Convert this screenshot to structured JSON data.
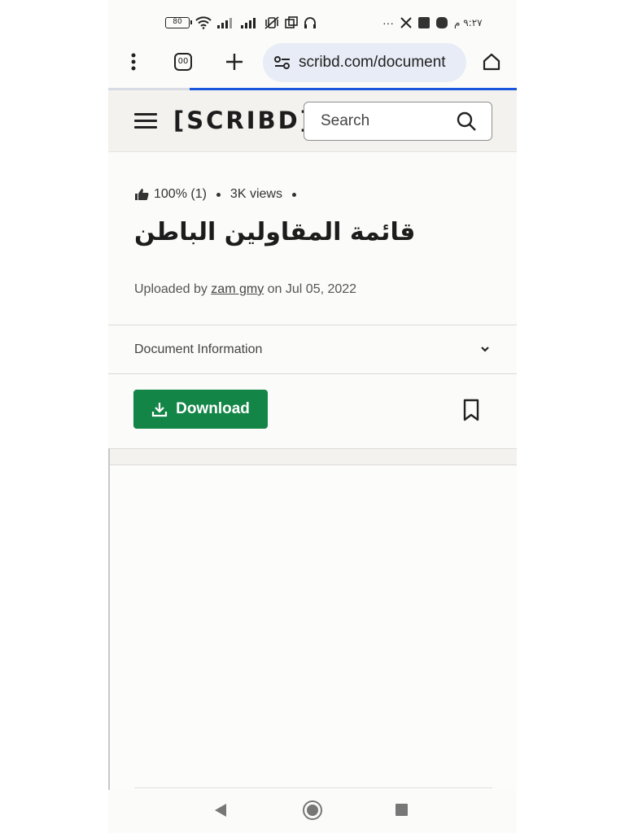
{
  "status_bar": {
    "battery": "80",
    "time": "٩:٢٧ م",
    "more": "···"
  },
  "browser": {
    "tab_count": "00",
    "url": "scribd.com/document"
  },
  "header": {
    "logo": "[SCRIBD]",
    "search_placeholder": "Search"
  },
  "document": {
    "rating": "100% (1)",
    "views": "3K views",
    "title": "قائمة المقاولين الباطن",
    "uploaded_prefix": "Uploaded by",
    "uploader": "zam gmy",
    "uploaded_date": "on Jul 05, 2022",
    "info_label": "Document Information"
  },
  "actions": {
    "download_label": "Download"
  },
  "colors": {
    "download_green": "#138547",
    "progress_blue": "#1a56db",
    "header_bg": "#f3f2ef"
  }
}
